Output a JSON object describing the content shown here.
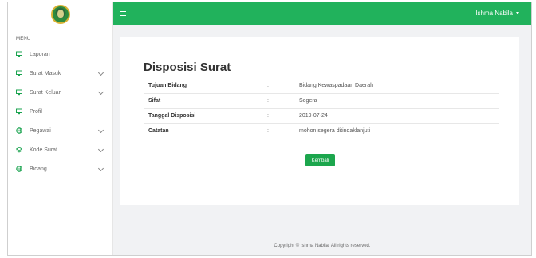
{
  "sidebar": {
    "menu_title": "MENU",
    "items": [
      {
        "label": "Laporan",
        "icon": "screen-icon",
        "has_children": false
      },
      {
        "label": "Surat Masuk",
        "icon": "screen-icon",
        "has_children": true
      },
      {
        "label": "Surat Keluar",
        "icon": "screen-icon",
        "has_children": true
      },
      {
        "label": "Profil",
        "icon": "screen-icon",
        "has_children": false
      },
      {
        "label": "Pegawai",
        "icon": "globe-icon",
        "has_children": true
      },
      {
        "label": "Kode Surat",
        "icon": "stack-icon",
        "has_children": true
      },
      {
        "label": "Bidang",
        "icon": "globe-icon",
        "has_children": true
      }
    ]
  },
  "topbar": {
    "user_name": "Ishma Nabila",
    "accent_color": "#21b25c"
  },
  "page": {
    "title": "Disposisi Surat",
    "rows": [
      {
        "label": "Tujuan Bidang",
        "sep": ":",
        "value": "Bidang Kewaspadaan Daerah"
      },
      {
        "label": "Sifat",
        "sep": ":",
        "value": "Segera"
      },
      {
        "label": "Tanggal Disposisi",
        "sep": ":",
        "value": "2019-07-24"
      },
      {
        "label": "Catatan",
        "sep": ":",
        "value": "mohon segera ditindaklanjuti"
      }
    ],
    "back_button": "Kembali"
  },
  "footer": {
    "text": "Copyright © Ishma Nabila. All rights reserved."
  }
}
